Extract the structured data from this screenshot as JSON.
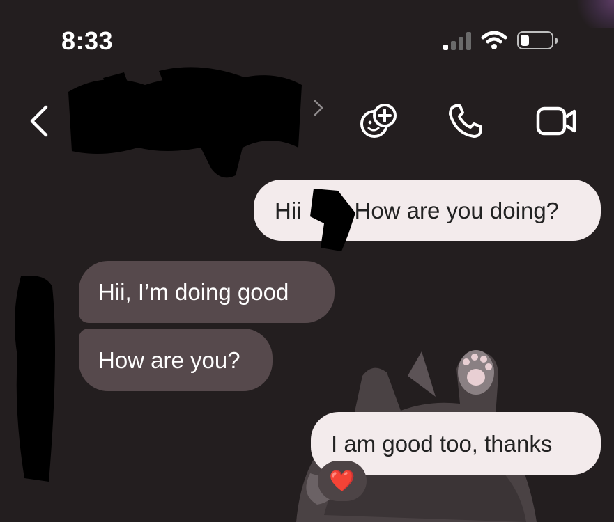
{
  "status_bar": {
    "time": "8:33",
    "signal_icon": "cellular-signal-icon",
    "wifi_icon": "wifi-icon",
    "battery_icon": "battery-low-icon"
  },
  "header": {
    "back_icon": "chevron-left-icon",
    "contact_name_redacted": true,
    "chevron_icon": "chevron-right-icon",
    "actions": [
      "add-effect-icon",
      "phone-call-icon",
      "video-call-icon"
    ]
  },
  "messages": [
    {
      "side": "outgoing",
      "text_before": "Hii",
      "text_after": "How are you doing?"
    },
    {
      "side": "incoming",
      "text": "Hii, I’m doing good"
    },
    {
      "side": "incoming",
      "text": "How are you?"
    },
    {
      "side": "outgoing",
      "text": "I am good too, thanks",
      "reaction": "❤️"
    }
  ],
  "colors": {
    "background": "#231e1f",
    "outgoing_bubble": "#f3ebec",
    "incoming_bubble": "#56494c"
  }
}
